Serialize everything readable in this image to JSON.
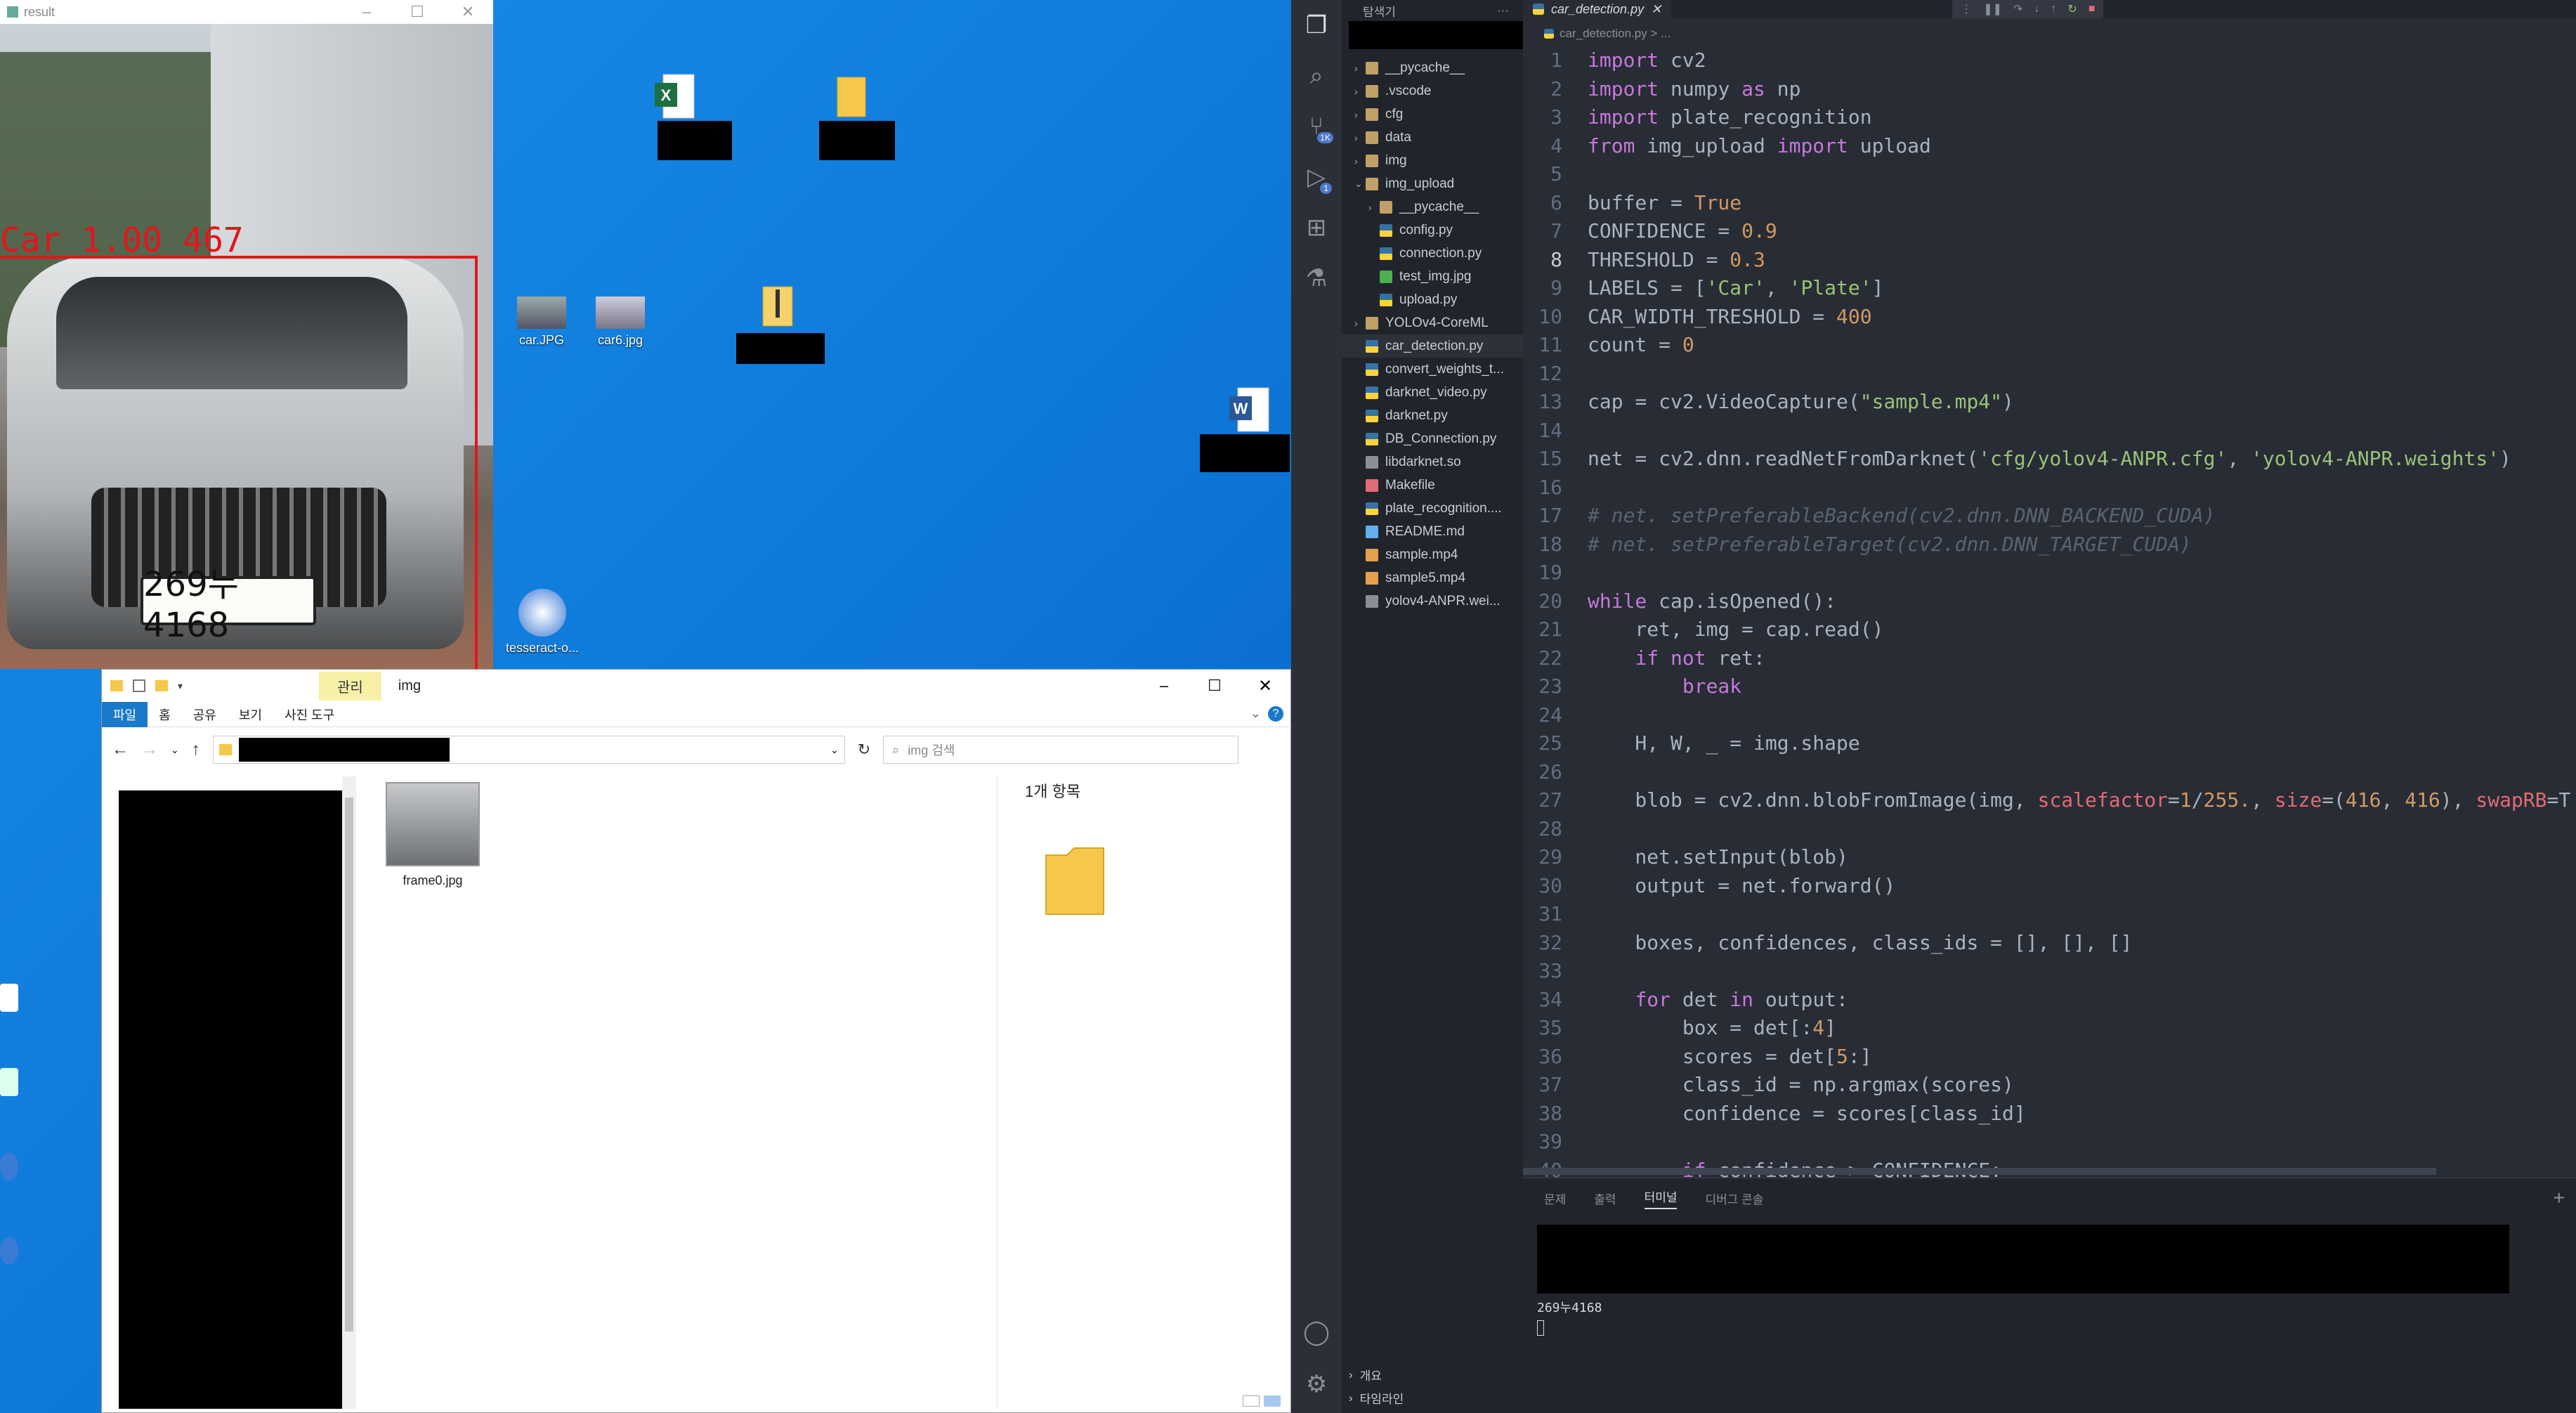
{
  "desktop": {
    "icons": [
      {
        "label": "car.JPG"
      },
      {
        "label": "car6.jpg"
      },
      {
        "label": "tesseract-o..."
      }
    ]
  },
  "result_window": {
    "title": "result",
    "detection_label": "Car 1.00 467",
    "plate_text": "269누4168"
  },
  "explorer": {
    "title": "img",
    "ribbon_manage": "관리",
    "tabs": [
      "파일",
      "홈",
      "공유",
      "보기",
      "사진 도구"
    ],
    "search_placeholder": "img 검색",
    "item_count": "1개 항목",
    "files": [
      {
        "name": "frame0.jpg"
      }
    ]
  },
  "vscode": {
    "sidebar_title": "탐색기",
    "sidebar_menu": "···",
    "tab_name": "car_detection.py",
    "breadcrumb": "car_detection.py > ...",
    "scm_badge": "1K",
    "debug_badge": "1",
    "tree": [
      {
        "label": "__pycache__",
        "type": "folder",
        "depth": 0
      },
      {
        "label": ".vscode",
        "type": "folder",
        "depth": 0
      },
      {
        "label": "cfg",
        "type": "folder",
        "depth": 0
      },
      {
        "label": "data",
        "type": "folder",
        "depth": 0
      },
      {
        "label": "img",
        "type": "folder",
        "depth": 0
      },
      {
        "label": "img_upload",
        "type": "folder-open",
        "depth": 0
      },
      {
        "label": "__pycache__",
        "type": "folder",
        "depth": 1
      },
      {
        "label": "config.py",
        "type": "py",
        "depth": 1
      },
      {
        "label": "connection.py",
        "type": "py",
        "depth": 1
      },
      {
        "label": "test_img.jpg",
        "type": "img",
        "depth": 1
      },
      {
        "label": "upload.py",
        "type": "py",
        "depth": 1
      },
      {
        "label": "YOLOv4-CoreML",
        "type": "folder",
        "depth": 0
      },
      {
        "label": "car_detection.py",
        "type": "py",
        "depth": 0,
        "selected": true
      },
      {
        "label": "convert_weights_t...",
        "type": "py",
        "depth": 0
      },
      {
        "label": "darknet_video.py",
        "type": "py",
        "depth": 0
      },
      {
        "label": "darknet.py",
        "type": "py",
        "depth": 0
      },
      {
        "label": "DB_Connection.py",
        "type": "py",
        "depth": 0
      },
      {
        "label": "libdarknet.so",
        "type": "file",
        "depth": 0
      },
      {
        "label": "Makefile",
        "type": "make",
        "depth": 0
      },
      {
        "label": "plate_recognition....",
        "type": "py",
        "depth": 0
      },
      {
        "label": "README.md",
        "type": "info",
        "depth": 0
      },
      {
        "label": "sample.mp4",
        "type": "video",
        "depth": 0
      },
      {
        "label": "sample5.mp4",
        "type": "video",
        "depth": 0
      },
      {
        "label": "yolov4-ANPR.wei...",
        "type": "file",
        "depth": 0
      }
    ],
    "outline": "개요",
    "timeline": "타임라인",
    "panel_tabs": [
      "문제",
      "출력",
      "터미널",
      "디버그 콘솔"
    ],
    "terminal_output": "269누4168",
    "code": [
      [
        [
          "kw",
          "import"
        ],
        [
          "pl",
          " cv2"
        ]
      ],
      [
        [
          "kw",
          "import"
        ],
        [
          "pl",
          " numpy "
        ],
        [
          "kw",
          "as"
        ],
        [
          "pl",
          " np"
        ]
      ],
      [
        [
          "kw",
          "import"
        ],
        [
          "pl",
          " plate_recognition"
        ]
      ],
      [
        [
          "kw",
          "from"
        ],
        [
          "pl",
          " img_upload "
        ],
        [
          "kw",
          "import"
        ],
        [
          "pl",
          " upload"
        ]
      ],
      [],
      [
        [
          "pl",
          "buffer = "
        ],
        [
          "num",
          "True"
        ]
      ],
      [
        [
          "pl",
          "CONFIDENCE = "
        ],
        [
          "num",
          "0.9"
        ]
      ],
      [
        [
          "pl",
          "THRESHOLD = "
        ],
        [
          "num",
          "0.3"
        ]
      ],
      [
        [
          "pl",
          "LABELS = ["
        ],
        [
          "str",
          "'Car'"
        ],
        [
          "pl",
          ", "
        ],
        [
          "str",
          "'Plate'"
        ],
        [
          "pl",
          "]"
        ]
      ],
      [
        [
          "pl",
          "CAR_WIDTH_TRESHOLD = "
        ],
        [
          "num",
          "400"
        ]
      ],
      [
        [
          "pl",
          "count = "
        ],
        [
          "num",
          "0"
        ]
      ],
      [],
      [
        [
          "pl",
          "cap = cv2.VideoCapture("
        ],
        [
          "str",
          "\"sample.mp4\""
        ],
        [
          "pl",
          ")"
        ]
      ],
      [],
      [
        [
          "pl",
          "net = cv2.dnn.readNetFromDarknet("
        ],
        [
          "str",
          "'cfg/yolov4-ANPR.cfg'"
        ],
        [
          "pl",
          ", "
        ],
        [
          "str",
          "'yolov4-ANPR.weights'"
        ],
        [
          "pl",
          ")"
        ]
      ],
      [],
      [
        [
          "cm",
          "# net. setPreferableBackend(cv2.dnn.DNN_BACKEND_CUDA)"
        ]
      ],
      [
        [
          "cm",
          "# net. setPreferableTarget(cv2.dnn.DNN_TARGET_CUDA)"
        ]
      ],
      [],
      [
        [
          "kw",
          "while"
        ],
        [
          "pl",
          " cap.isOpened():"
        ]
      ],
      [
        [
          "pl",
          "    ret, img = cap.read()"
        ]
      ],
      [
        [
          "pl",
          "    "
        ],
        [
          "kw",
          "if not"
        ],
        [
          "pl",
          " ret:"
        ]
      ],
      [
        [
          "pl",
          "        "
        ],
        [
          "kw",
          "break"
        ]
      ],
      [],
      [
        [
          "pl",
          "    H, W, _ = img.shape"
        ]
      ],
      [],
      [
        [
          "pl",
          "    blob = cv2.dnn.blobFromImage(img, "
        ],
        [
          "pm",
          "scalefactor"
        ],
        [
          "pl",
          "="
        ],
        [
          "num",
          "1"
        ],
        [
          "pl",
          "/"
        ],
        [
          "num",
          "255."
        ],
        [
          "pl",
          ", "
        ],
        [
          "pm",
          "size"
        ],
        [
          "pl",
          "=("
        ],
        [
          "num",
          "416"
        ],
        [
          "pl",
          ", "
        ],
        [
          "num",
          "416"
        ],
        [
          "pl",
          "), "
        ],
        [
          "pm",
          "swapRB"
        ],
        [
          "pl",
          "=T"
        ]
      ],
      [],
      [
        [
          "pl",
          "    net.setInput(blob)"
        ]
      ],
      [
        [
          "pl",
          "    output = net.forward()"
        ]
      ],
      [],
      [
        [
          "pl",
          "    boxes, confidences, class_ids = [], [], []"
        ]
      ],
      [],
      [
        [
          "pl",
          "    "
        ],
        [
          "kw",
          "for"
        ],
        [
          "pl",
          " det "
        ],
        [
          "kw",
          "in"
        ],
        [
          "pl",
          " output:"
        ]
      ],
      [
        [
          "pl",
          "        box = det[:"
        ],
        [
          "num",
          "4"
        ],
        [
          "pl",
          "]"
        ]
      ],
      [
        [
          "pl",
          "        scores = det["
        ],
        [
          "num",
          "5"
        ],
        [
          "pl",
          ":]"
        ]
      ],
      [
        [
          "pl",
          "        class_id = np.argmax(scores)"
        ]
      ],
      [
        [
          "pl",
          "        confidence = scores[class_id]"
        ]
      ],
      [],
      [
        [
          "pl",
          "        "
        ],
        [
          "kw",
          "if"
        ],
        [
          "pl",
          " confidence > CONFIDENCE:"
        ]
      ]
    ]
  }
}
